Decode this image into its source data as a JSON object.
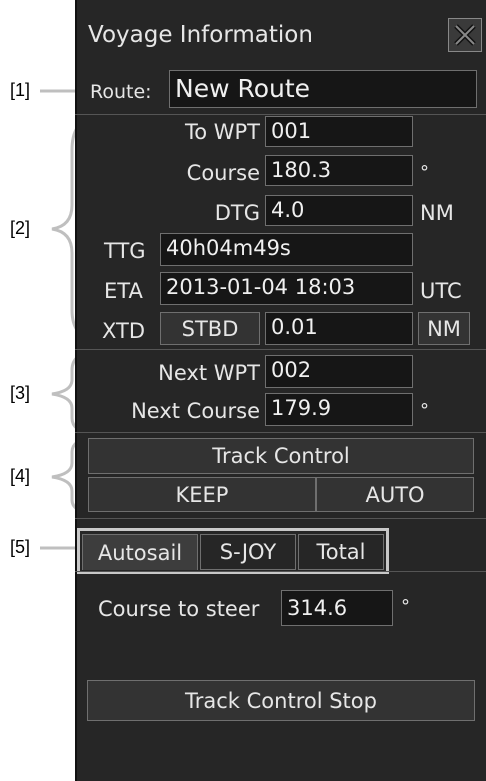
{
  "window": {
    "title": "Voyage Information"
  },
  "route": {
    "label": "Route:",
    "value": "New Route"
  },
  "nav": {
    "to_wpt_label": "To WPT",
    "to_wpt_value": "001",
    "course_label": "Course",
    "course_value": "180.3",
    "course_unit": "°",
    "dtg_label": "DTG",
    "dtg_value": "4.0",
    "dtg_unit": "NM",
    "ttg_label": "TTG",
    "ttg_value": "40h04m49s",
    "eta_label": "ETA",
    "eta_value": "2013-01-04 18:03",
    "eta_unit": "UTC",
    "xtd_label": "XTD",
    "xtd_side": "STBD",
    "xtd_value": "0.01",
    "xtd_unit": "NM"
  },
  "next": {
    "wpt_label": "Next WPT",
    "wpt_value": "002",
    "course_label": "Next Course",
    "course_value": "179.9",
    "course_unit": "°"
  },
  "track_control": {
    "title": "Track Control",
    "mode_left": "KEEP",
    "mode_right": "AUTO"
  },
  "tabs": [
    {
      "label": "Autosail"
    },
    {
      "label": "S-JOY"
    },
    {
      "label": "Total"
    }
  ],
  "autosail": {
    "course_label": "Course to steer",
    "course_value": "314.6",
    "course_unit": "°",
    "stop_button": "Track Control Stop"
  },
  "annotations": {
    "a1": "[1]",
    "a2": "[2]",
    "a3": "[3]",
    "a4": "[4]",
    "a5": "[5]"
  }
}
